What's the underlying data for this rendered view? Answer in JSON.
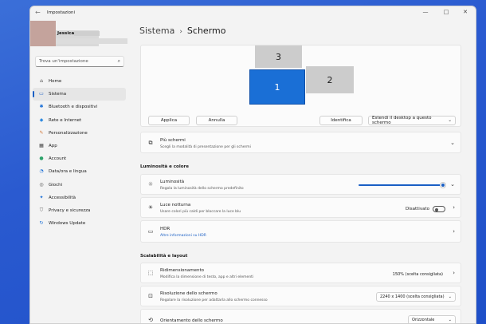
{
  "window": {
    "title": "Impostazioni",
    "back_icon": "arrow-left-icon"
  },
  "user": {
    "name": "Jessica"
  },
  "search": {
    "placeholder": "Trova un'impostazione"
  },
  "sidebar": {
    "items": [
      {
        "label": "Home",
        "icon": "home-icon",
        "glyph": "⌂",
        "color": "#444444"
      },
      {
        "label": "Sistema",
        "icon": "system-icon",
        "glyph": "▭",
        "color": "#1a5fc4",
        "active": true
      },
      {
        "label": "Bluetooth e dispositivi",
        "icon": "bluetooth-icon",
        "glyph": "✱",
        "color": "#1a6fd6"
      },
      {
        "label": "Rete e Internet",
        "icon": "network-icon",
        "glyph": "◆",
        "color": "#2f8ae0"
      },
      {
        "label": "Personalizzazione",
        "icon": "brush-icon",
        "glyph": "✎",
        "color": "#d27a3a"
      },
      {
        "label": "App",
        "icon": "apps-icon",
        "glyph": "▦",
        "color": "#444444"
      },
      {
        "label": "Account",
        "icon": "account-icon",
        "glyph": "●",
        "color": "#2ea36b"
      },
      {
        "label": "Data/ora e lingua",
        "icon": "globe-clock-icon",
        "glyph": "◔",
        "color": "#1a6fd6"
      },
      {
        "label": "Giochi",
        "icon": "gamepad-icon",
        "glyph": "◎",
        "color": "#555555"
      },
      {
        "label": "Accessibilità",
        "icon": "accessibility-icon",
        "glyph": "✦",
        "color": "#1a6fd6"
      },
      {
        "label": "Privacy e sicurezza",
        "icon": "shield-icon",
        "glyph": "⛉",
        "color": "#666666"
      },
      {
        "label": "Windows Update",
        "icon": "update-icon",
        "glyph": "↻",
        "color": "#1a6fd6"
      }
    ]
  },
  "breadcrumb": {
    "parent": "Sistema",
    "current": "Schermo"
  },
  "displays": {
    "monitor_1": "1",
    "monitor_2": "2",
    "monitor_3": "3"
  },
  "display_buttons": {
    "apply": "Applica",
    "cancel": "Annulla",
    "identify": "Identifica",
    "extend": "Estendi il desktop a questo schermo"
  },
  "multi_display": {
    "title": "Più schermi",
    "desc": "Scegli la modalità di presentazione per gli schermi"
  },
  "section_brightness": "Luminosità e colore",
  "brightness": {
    "title": "Luminosità",
    "desc": "Regola la luminosità dello schermo predefinito",
    "level_percent": 100
  },
  "night_light": {
    "title": "Luce notturna",
    "desc": "Usare colori più caldi per bloccare la luce blu",
    "state": "Disattivato"
  },
  "hdr": {
    "title": "HDR",
    "desc": "Altre informazioni su HDR"
  },
  "section_scale": "Scalabilità e layout",
  "scale": {
    "title": "Ridimensionamento",
    "desc": "Modifica la dimensione di testo, app e altri elementi",
    "value": "150% (scelta consigliata)"
  },
  "resolution": {
    "title": "Risoluzione dello schermo",
    "desc": "Regolare la risoluzione per adattarla allo schermo connesso",
    "value": "2240 x 1400 (scelta consigliata)"
  },
  "orientation": {
    "title": "Orientamento dello schermo",
    "value": "Orizzontale"
  },
  "colors": {
    "accent": "#1a5fc4",
    "monitor_active": "#1a6fd6"
  }
}
